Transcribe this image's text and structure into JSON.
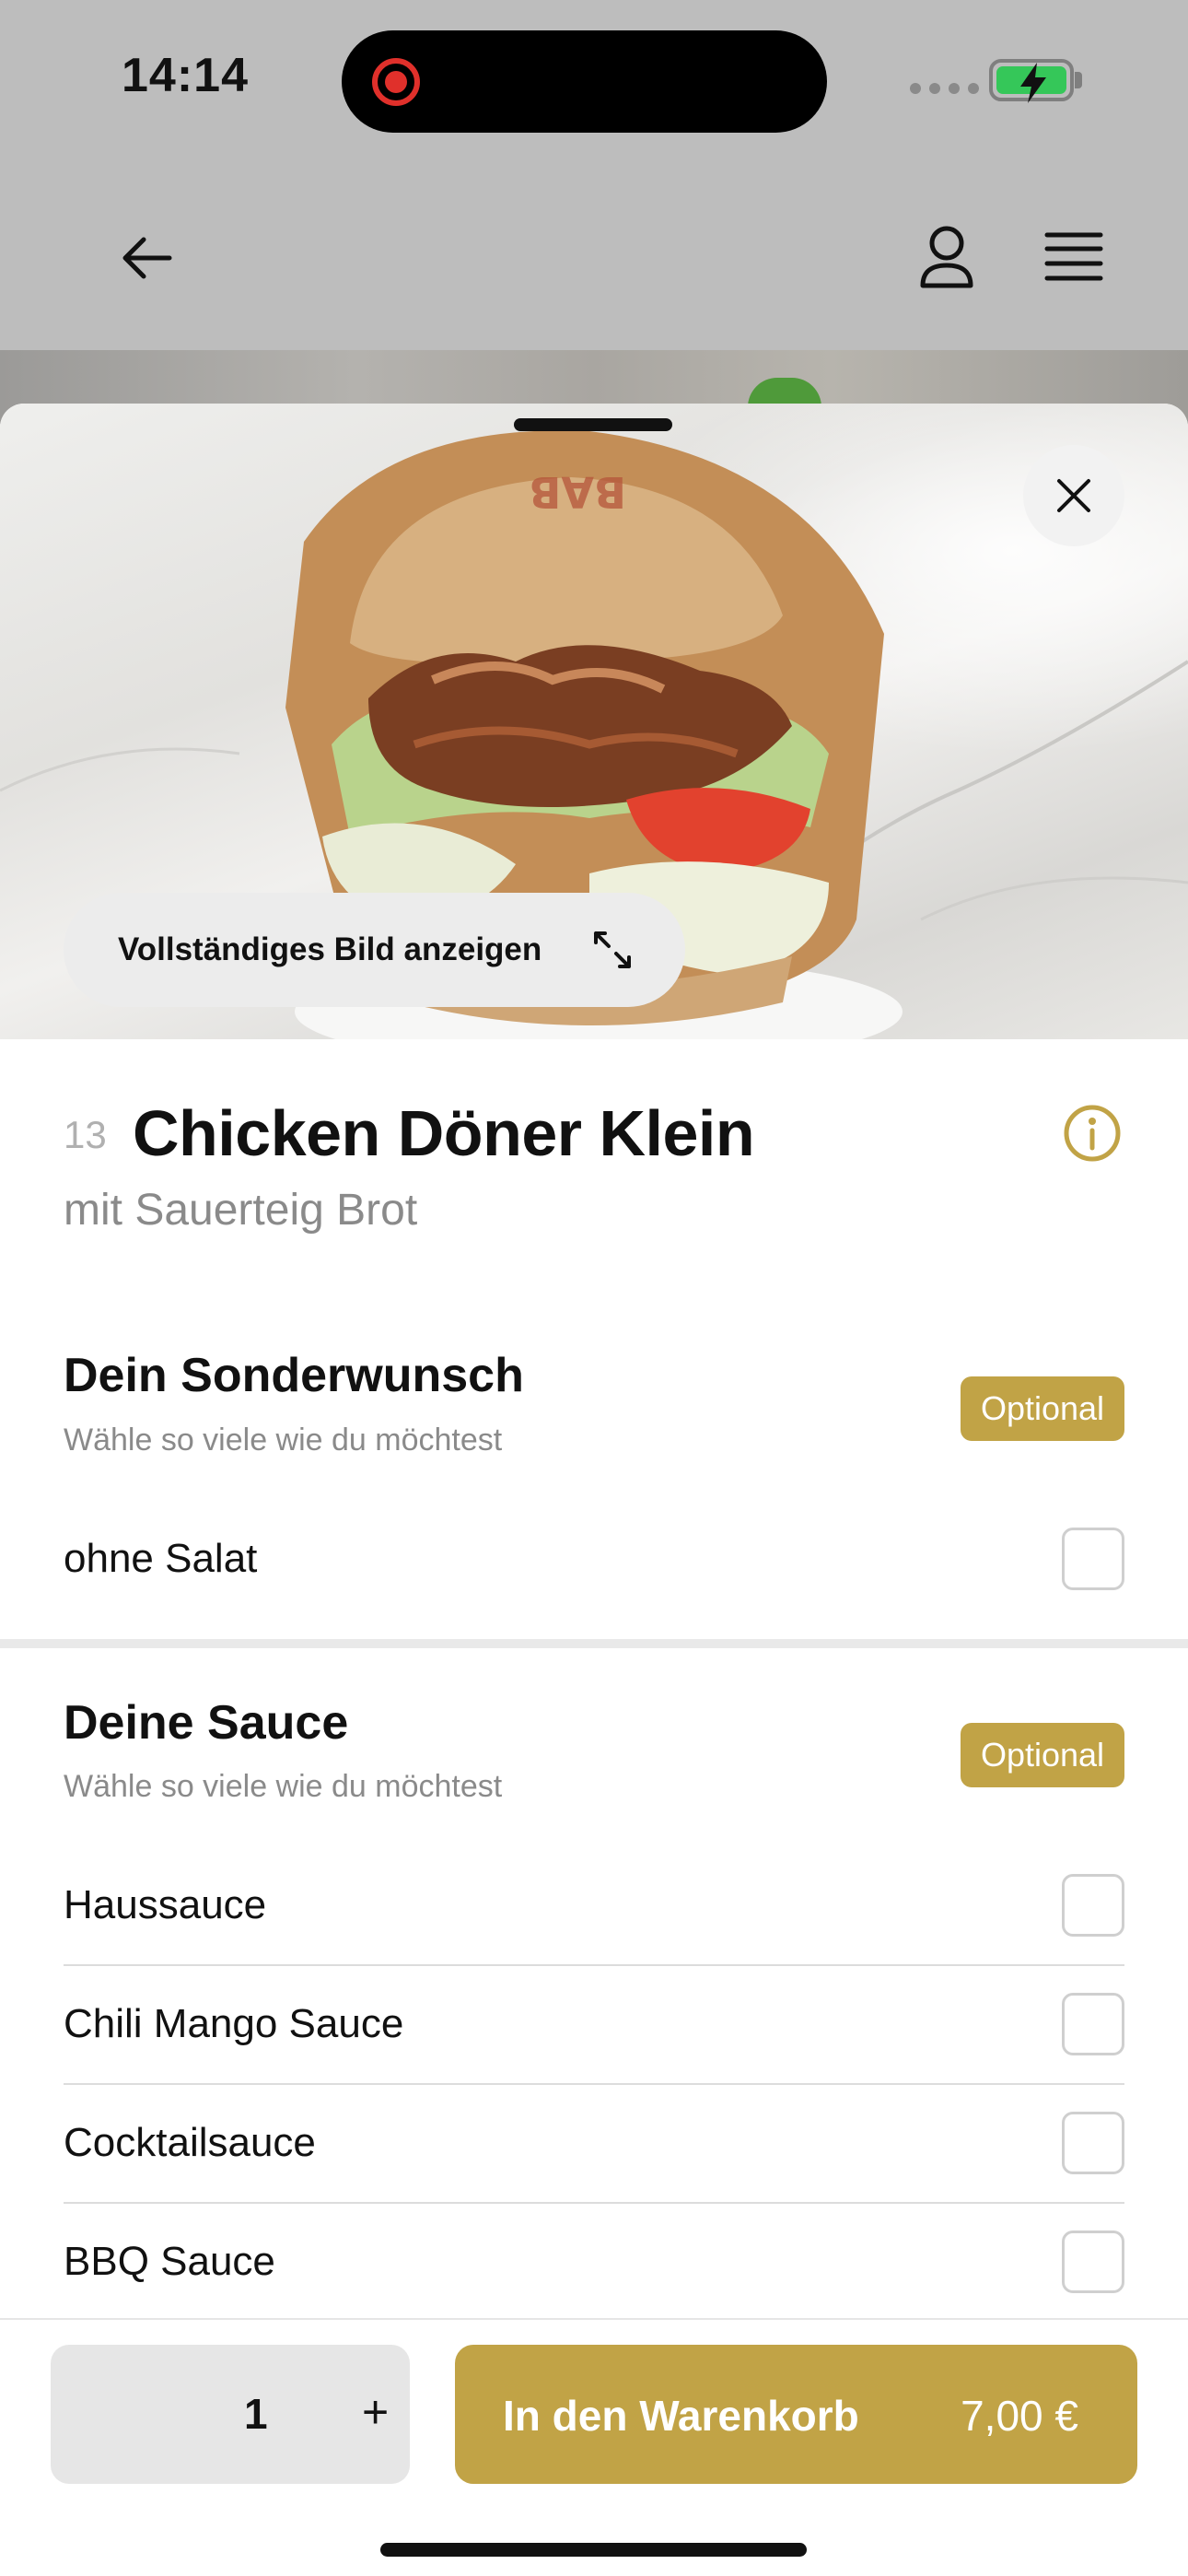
{
  "status_bar": {
    "time": "14:14"
  },
  "hero": {
    "full_image_label": "Vollständiges Bild anzeigen"
  },
  "product": {
    "number": "13",
    "title": "Chicken Döner Klein",
    "subtitle": "mit Sauerteig Brot"
  },
  "groups": [
    {
      "title": "Dein Sonderwunsch",
      "hint": "Wähle so viele wie du möchtest",
      "badge": "Optional",
      "options": [
        {
          "label": "ohne Salat",
          "checked": false
        }
      ]
    },
    {
      "title": "Deine Sauce",
      "hint": "Wähle so viele wie du möchtest",
      "badge": "Optional",
      "options": [
        {
          "label": "Haussauce",
          "checked": false
        },
        {
          "label": "Chili Mango Sauce",
          "checked": false
        },
        {
          "label": "Cocktailsauce",
          "checked": false
        },
        {
          "label": "BBQ Sauce",
          "checked": false
        }
      ]
    }
  ],
  "cart": {
    "quantity": "1",
    "plus_label": "+",
    "add_label": "In den Warenkorb",
    "price": "7,00 €"
  },
  "colors": {
    "accent": "#c1a346",
    "battery": "#35c759",
    "record": "#e0302b"
  },
  "icons": [
    "back-arrow-icon",
    "user-icon",
    "menu-icon",
    "close-icon",
    "expand-icon",
    "info-icon"
  ]
}
